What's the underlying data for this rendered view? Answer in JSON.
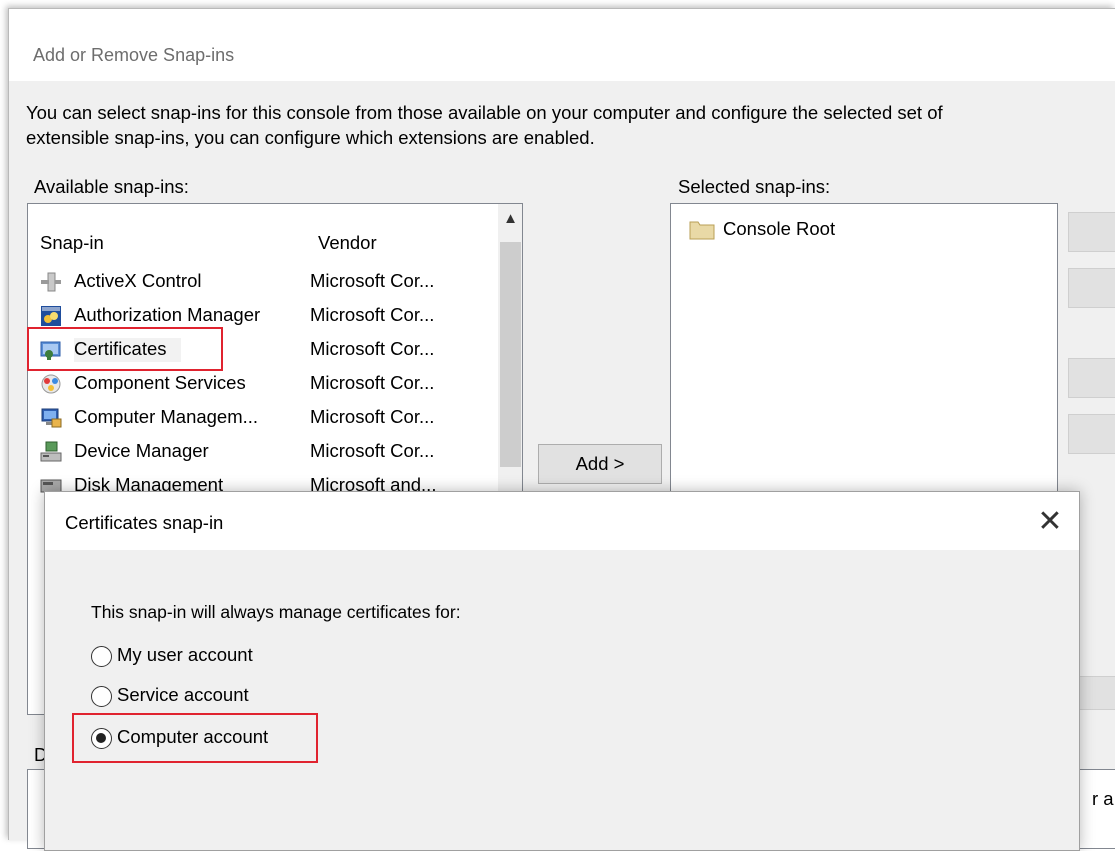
{
  "outer_dialog": {
    "title": "Add or Remove Snap-ins",
    "intro_line1": "You can select snap-ins for this console from those available on your computer and configure the selected set of",
    "intro_line2": "extensible snap-ins, you can configure which extensions are enabled.",
    "available_label": "Available snap-ins:",
    "selected_label": "Selected snap-ins:",
    "columns": {
      "snapin": "Snap-in",
      "vendor": "Vendor"
    },
    "available_items": [
      {
        "name": "ActiveX Control",
        "vendor": "Microsoft Cor...",
        "icon": "activex-icon"
      },
      {
        "name": "Authorization Manager",
        "vendor": "Microsoft Cor...",
        "icon": "authorization-manager-icon"
      },
      {
        "name": "Certificates",
        "vendor": "Microsoft Cor...",
        "icon": "certificates-icon"
      },
      {
        "name": "Component Services",
        "vendor": "Microsoft Cor...",
        "icon": "component-services-icon"
      },
      {
        "name": "Computer Managem...",
        "vendor": "Microsoft Cor...",
        "icon": "computer-management-icon"
      },
      {
        "name": "Device Manager",
        "vendor": "Microsoft Cor...",
        "icon": "device-manager-icon"
      },
      {
        "name": "Disk Management",
        "vendor": "Microsoft and...",
        "icon": "disk-management-icon"
      }
    ],
    "add_button": "Add >",
    "selected_items": [
      {
        "name": "Console Root",
        "icon": "folder-icon"
      }
    ],
    "partial_label_left": "D",
    "partial_text_right": "r a"
  },
  "certificates_dialog": {
    "title": "Certificates snap-in",
    "close_glyph": "✕",
    "prompt": "This snap-in will always manage certificates for:",
    "options": [
      {
        "label": "My user account",
        "checked": false
      },
      {
        "label": "Service account",
        "checked": false
      },
      {
        "label": "Computer account",
        "checked": true
      }
    ]
  },
  "colors": {
    "highlight_box": "#e0232f",
    "dialog_bg": "#f0f0f0"
  }
}
